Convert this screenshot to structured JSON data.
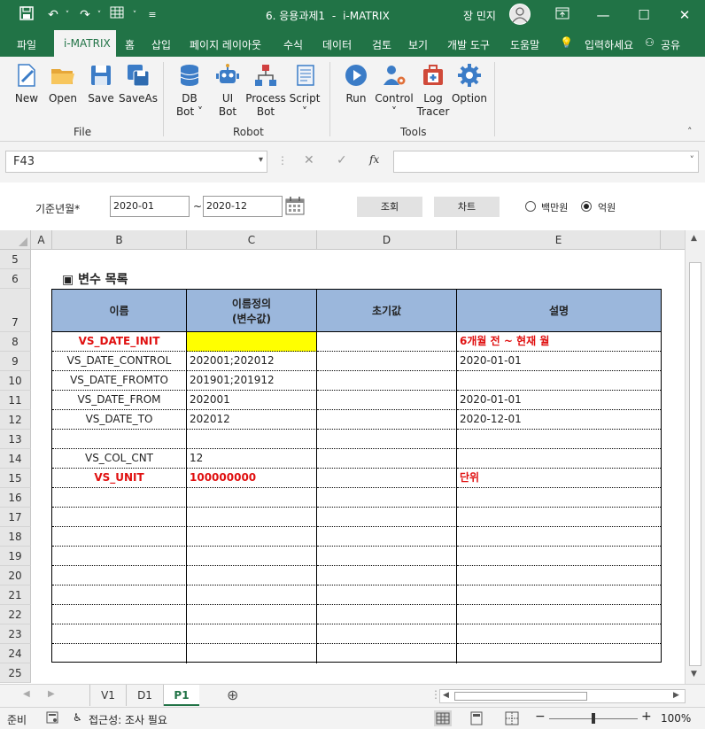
{
  "title": {
    "doc_title": "6. 응용과제1",
    "separator": "-",
    "app_name": "i-MATRIX",
    "user_name": "장 민지"
  },
  "menu": {
    "items": [
      "파일",
      "i-MATRIX",
      "홈",
      "삽입",
      "페이지 레이아웃",
      "수식",
      "데이터",
      "검토",
      "보기",
      "개발 도구",
      "도움말"
    ],
    "tell_me": "입력하세요",
    "share": "공유"
  },
  "ribbon": {
    "file_group": {
      "label": "File",
      "buttons": [
        "New",
        "Open",
        "Save",
        "SaveAs"
      ]
    },
    "robot_group": {
      "label": "Robot",
      "buttons": [
        {
          "l1": "DB",
          "l2": "Bot ˅"
        },
        {
          "l1": "UI",
          "l2": "Bot"
        },
        {
          "l1": "Process",
          "l2": "Bot"
        },
        {
          "l1": "Script",
          "l2": "˅"
        }
      ]
    },
    "tools_group": {
      "label": "Tools",
      "buttons": [
        {
          "l1": "Run",
          "l2": ""
        },
        {
          "l1": "Control",
          "l2": "˅"
        },
        {
          "l1": "Log",
          "l2": "Tracer"
        },
        {
          "l1": "Option",
          "l2": ""
        }
      ]
    }
  },
  "formula_bar": {
    "name_box": "F43",
    "fx": "fx",
    "value": ""
  },
  "params": {
    "label": "기준년월*",
    "from": "2020-01",
    "tilde": "~",
    "to": "2020-12",
    "search_button": "조회",
    "chart_button": "차트",
    "unit_options": [
      {
        "label": "백만원",
        "selected": false
      },
      {
        "label": "억원",
        "selected": true
      }
    ]
  },
  "columns": [
    "A",
    "B",
    "C",
    "D",
    "E"
  ],
  "rows": [
    "5",
    "6",
    "7",
    "8",
    "9",
    "10",
    "11",
    "12",
    "13",
    "14",
    "15",
    "16",
    "17",
    "18",
    "19",
    "20",
    "21",
    "22",
    "23",
    "24",
    "25"
  ],
  "section_title": "▣ 변수 목록",
  "table": {
    "headers": {
      "name": "이름",
      "def_line1": "이름정의",
      "def_line2": "(변수값)",
      "init": "초기값",
      "desc": "설명"
    },
    "rows": [
      {
        "name": "VS_DATE_INIT",
        "def": "",
        "init": "",
        "desc": "6개월 전 ~ 현재 월",
        "red": true,
        "yellow": true
      },
      {
        "name": "VS_DATE_CONTROL",
        "def": "202001;202012",
        "init": "",
        "desc": "2020-01-01"
      },
      {
        "name": "VS_DATE_FROMTO",
        "def": "201901;201912",
        "init": "",
        "desc": ""
      },
      {
        "name": "VS_DATE_FROM",
        "def": "202001",
        "init": "",
        "desc": "2020-01-01"
      },
      {
        "name": "VS_DATE_TO",
        "def": "202012",
        "init": "",
        "desc": "2020-12-01"
      },
      {
        "name": "",
        "def": "",
        "init": "",
        "desc": ""
      },
      {
        "name": "VS_COL_CNT",
        "def": "12",
        "init": "",
        "desc": ""
      },
      {
        "name": "VS_UNIT",
        "def": "100000000",
        "init": "",
        "desc": "단위",
        "red": true
      },
      {
        "name": "",
        "def": "",
        "init": "",
        "desc": ""
      },
      {
        "name": "",
        "def": "",
        "init": "",
        "desc": ""
      },
      {
        "name": "",
        "def": "",
        "init": "",
        "desc": ""
      },
      {
        "name": "",
        "def": "",
        "init": "",
        "desc": ""
      },
      {
        "name": "",
        "def": "",
        "init": "",
        "desc": ""
      },
      {
        "name": "",
        "def": "",
        "init": "",
        "desc": ""
      },
      {
        "name": "",
        "def": "",
        "init": "",
        "desc": ""
      },
      {
        "name": "",
        "def": "",
        "init": "",
        "desc": ""
      },
      {
        "name": "",
        "def": "",
        "init": "",
        "desc": ""
      }
    ]
  },
  "sheets": {
    "tabs": [
      "V1",
      "D1",
      "P1"
    ],
    "active": "P1"
  },
  "status": {
    "ready": "준비",
    "accessibility": "접근성: 조사 필요",
    "zoom": "100%",
    "zoom_level_percent": 100
  },
  "colors": {
    "brand": "#217346",
    "header_fill": "#9bb7dc",
    "yellow": "#ffff00",
    "red_text": "#e01010"
  }
}
